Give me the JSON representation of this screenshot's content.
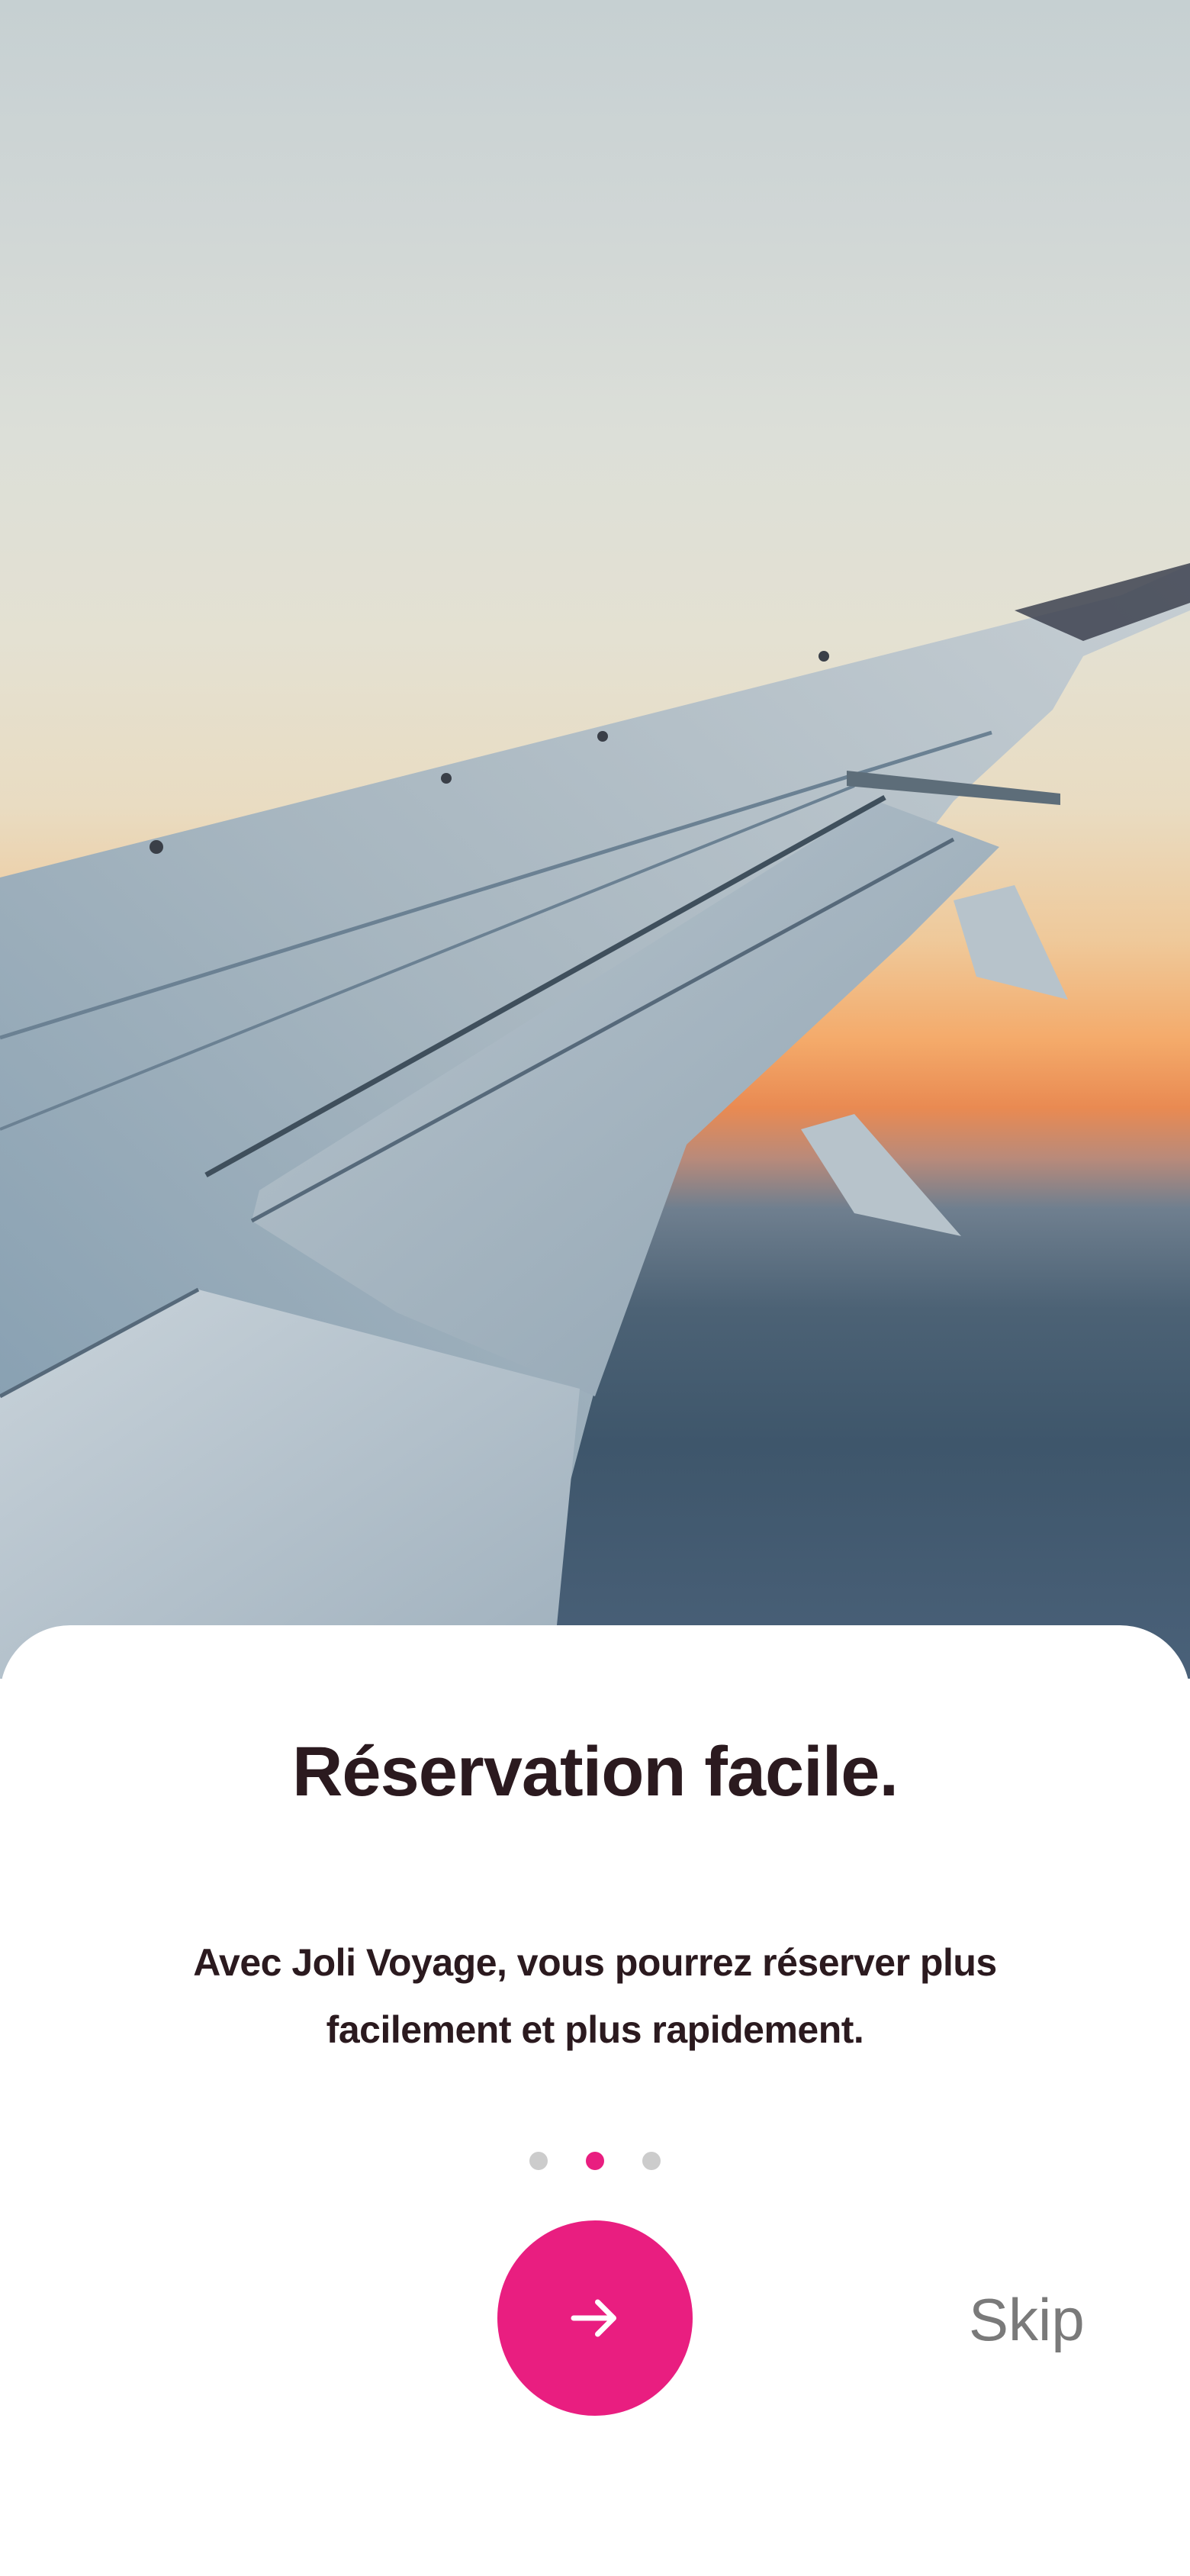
{
  "onboarding": {
    "title": "Réservation facile.",
    "subtitle": "Avec Joli Voyage, vous pourrez réserver plus facilement et plus rapidement.",
    "pagination": {
      "total": 3,
      "active_index": 1
    },
    "next_icon": "arrow-right-icon",
    "skip_label": "Skip"
  },
  "colors": {
    "accent": "#e91e80",
    "title_text": "#2b1a1f",
    "skip_text": "#7a7a7a",
    "dot_inactive": "#cccccc"
  }
}
